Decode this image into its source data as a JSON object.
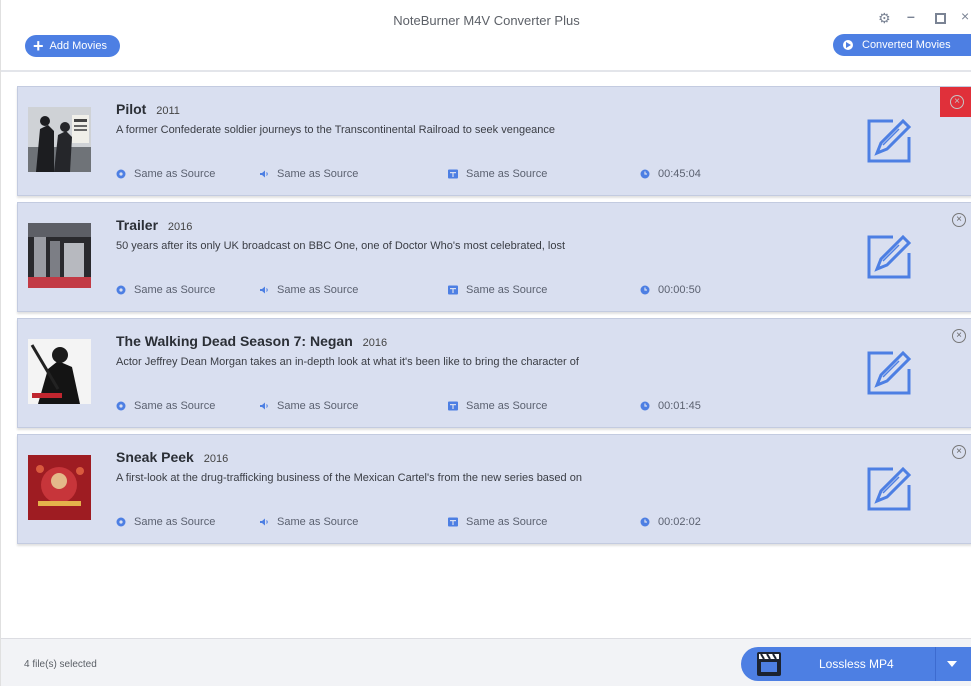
{
  "app": {
    "title": "NoteBurner M4V Converter Plus"
  },
  "toolbar": {
    "add_label": "Add Movies",
    "converted_label": "Converted Movies"
  },
  "movies": [
    {
      "title": "Pilot",
      "year": "2011",
      "description": "A former Confederate soldier journeys to the Transcontinental Railroad to seek vengeance",
      "video": "Same as Source",
      "audio": "Same as Source",
      "subtitle": "Same as Source",
      "duration": "00:45:04"
    },
    {
      "title": "Trailer",
      "year": "2016",
      "description": "50 years after its only UK broadcast on BBC One, one of Doctor Who's most celebrated, lost",
      "video": "Same as Source",
      "audio": "Same as Source",
      "subtitle": "Same as Source",
      "duration": "00:00:50"
    },
    {
      "title": "The Walking Dead Season 7: Negan",
      "year": "2016",
      "description": "Actor Jeffrey Dean Morgan takes an in-depth look at what it's been like to bring the character of",
      "video": "Same as Source",
      "audio": "Same as Source",
      "subtitle": "Same as Source",
      "duration": "00:01:45"
    },
    {
      "title": "Sneak Peek",
      "year": "2016",
      "description": "A first-look at the drug-trafficking business of the Mexican Cartel's from the new series based on",
      "video": "Same as Source",
      "audio": "Same as Source",
      "subtitle": "Same as Source",
      "duration": "00:02:02"
    }
  ],
  "footer": {
    "status": "4 file(s) selected",
    "output_format": "Lossless MP4"
  },
  "colors": {
    "accent": "#4d7fe3",
    "row_bg": "#d9dff0",
    "highlight": "#e0303a"
  },
  "icons": [
    "plus-icon",
    "play-circle-icon",
    "gear-icon",
    "minimize-icon",
    "maximize-icon",
    "close-window-icon",
    "video-settings-icon",
    "audio-icon",
    "subtitle-icon",
    "clock-icon",
    "edit-icon",
    "remove-icon",
    "clapperboard-icon",
    "chevron-down-icon"
  ]
}
